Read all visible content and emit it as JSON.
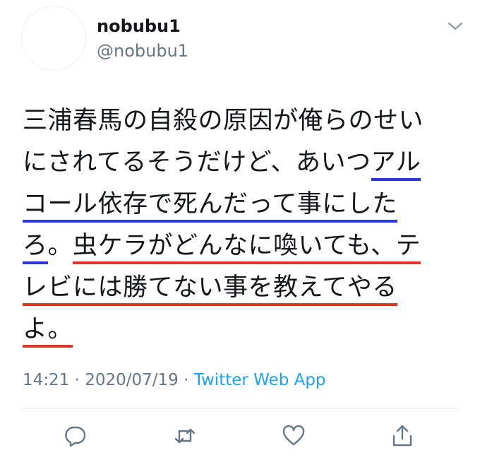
{
  "tweet": {
    "display_name": "nobubu1",
    "handle": "@nobubu1",
    "text_lines": {
      "l1": "三浦春馬の自殺の原因が俺らのせい",
      "l2a": "にされてるそうだけど、あいつ",
      "l2b": "アル",
      "l3": "コール依存で死んだって事にした",
      "l4a": "ろ",
      "l4b": "。",
      "l4c": "虫ケラがどんなに喚いても、テ",
      "l5": "レビには勝てない事を教えてやる",
      "l6": "よ。"
    },
    "time": "14:21",
    "date": "2020/07/19",
    "separator": "·",
    "source": "Twitter Web App"
  },
  "actions": [
    "reply-icon",
    "retweet-icon",
    "like-icon",
    "share-icon"
  ],
  "colors": {
    "underline_blue": "#2a36d6",
    "underline_red": "#e1352b",
    "link": "#1da1f2",
    "secondary": "#657786"
  }
}
